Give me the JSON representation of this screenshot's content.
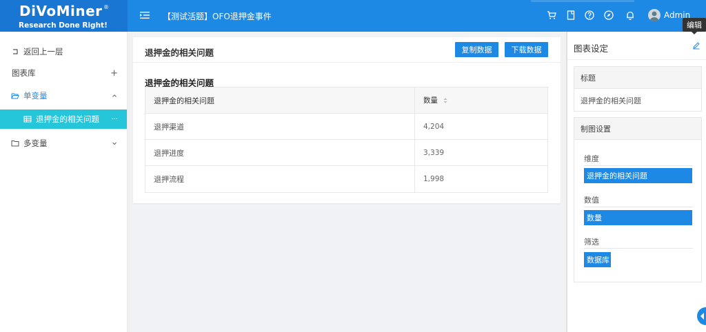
{
  "header": {
    "logo_main": "DiVoMiner",
    "logo_reg": "®",
    "logo_sub": "Research Done Right!",
    "page_title": "【测试活题】OFO退押金事件",
    "user_name": "Admin",
    "tooltip": "编辑"
  },
  "sidebar": {
    "back": "返回上一层",
    "chart_library": "图表库",
    "chart_library_action": "+",
    "univariate": "单变量",
    "selected_item": "退押金的相关问题",
    "selected_more": "···",
    "multivariate": "多变量"
  },
  "main": {
    "title": "退押金的相关问题",
    "copy_button": "复制数据",
    "download_button": "下载数据",
    "table_title": "退押金的相关问题",
    "table": {
      "headers": [
        "退押金的相关问题",
        "数量"
      ],
      "rows": [
        [
          "退押渠道",
          "4,204"
        ],
        [
          "退押进度",
          "3,339"
        ],
        [
          "退押流程",
          "1,998"
        ]
      ]
    }
  },
  "right_panel": {
    "title": "图表设定",
    "title_section": "标题",
    "title_value": "退押金的相关问题",
    "chart_settings": "制图设置",
    "dimension_label": "维度",
    "dimension_value": "退押金的相关问题",
    "value_label": "数值",
    "value_value": "数量",
    "filter_label": "筛选",
    "filter_value": "数据库"
  },
  "colors": {
    "primary": "#1e88e5",
    "selected": "#26c6da"
  }
}
